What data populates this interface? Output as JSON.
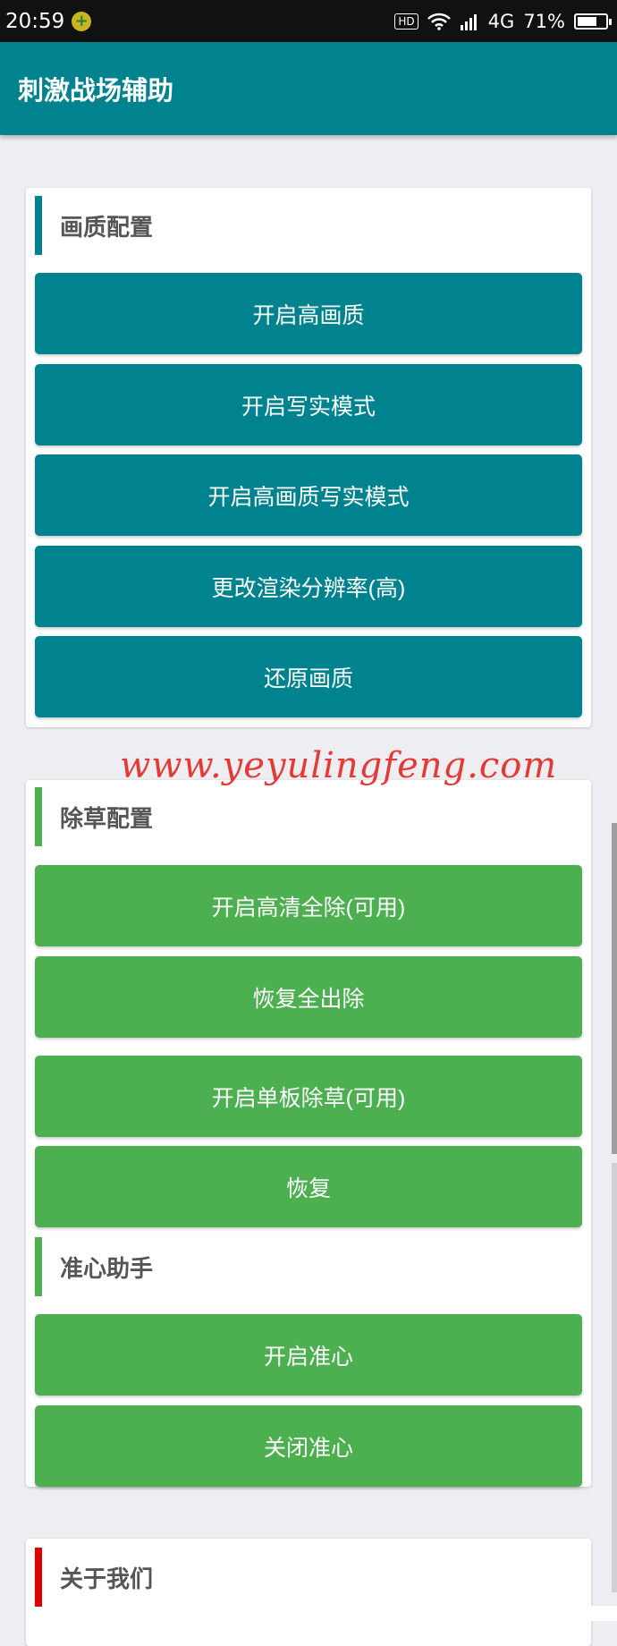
{
  "status_bar": {
    "time": "20:59",
    "hd": "HD",
    "network": "4G",
    "battery_pct": "71%",
    "battery_level": 0.71
  },
  "app_bar": {
    "title": "刺激战场辅助"
  },
  "sections": [
    {
      "title": "画质配置",
      "accent": "#00838f",
      "buttons": [
        "开启高画质",
        "开启写实模式",
        "开启高画质写实模式",
        "更改渲染分辨率(高)",
        "还原画质"
      ]
    },
    {
      "title": "除草配置",
      "accent": "#4caf50",
      "buttons": [
        "开启高清全除(可用)",
        "恢复全出除",
        "开启单板除草(可用)",
        "恢复"
      ]
    },
    {
      "title": "准心助手",
      "accent": "#4caf50",
      "buttons": [
        "开启准心",
        "关闭准心"
      ]
    },
    {
      "title": "关于我们",
      "accent": "#e00000",
      "buttons": []
    }
  ],
  "watermark": "www.yeyulingfeng.com",
  "icons": {
    "notification": "plus-circle-icon",
    "wifi": "wifi-icon",
    "signal": "signal-icon",
    "battery": "battery-icon"
  }
}
